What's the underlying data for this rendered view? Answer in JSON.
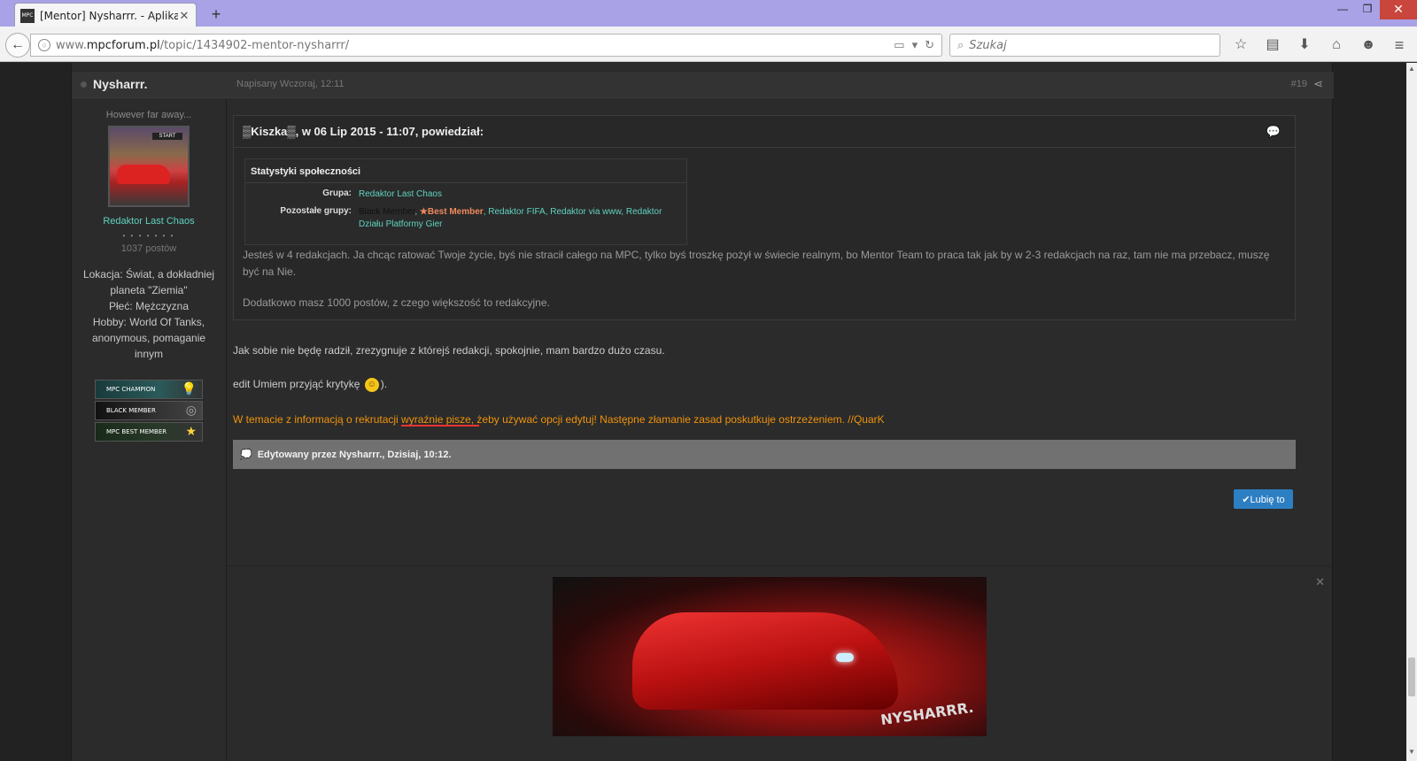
{
  "browser": {
    "tab_title": "[Mentor] Nysharrr. - Aplika...",
    "favicon_text": "MPC",
    "url_prefix": "www.",
    "url_domain": "mpcforum.pl",
    "url_path": "/topic/1434902-mentor-nysharrr/",
    "search_placeholder": "Szukaj"
  },
  "post": {
    "author": "Nysharrr.",
    "date": "Napisany Wczoraj, 12:11",
    "number": "#19"
  },
  "sidebar": {
    "user_title": "However far away...",
    "group": "Redaktor Last Chaos",
    "pips": "• • • • • • •",
    "post_count": "1037 postów",
    "fields": [
      "Lokacja: Świat, a dokładniej planeta \"Ziemia\"",
      "Płeć: Mężczyzna",
      "Hobby: World Of Tanks, anonymous, pomaganie innym"
    ],
    "badges": [
      "MPC CHAMPION",
      "BLACK MEMBER",
      "MPC BEST MEMBER"
    ]
  },
  "quote": {
    "header": "▒Kiszka▒, w 06 Lip 2015 - 11:07, powiedział:",
    "stats_title": "Statystyki społeczności",
    "group_label": "Grupa:",
    "group_value": "Redaktor Last Chaos",
    "other_label": "Pozostałe grupy:",
    "other_black": "Black Member",
    "other_best": "★Best Member",
    "other_rest": ", Redaktor FIFA, Redaktor via www, Redaktor Działu Platformy Gier",
    "text1": "Jesteś w 4 redakcjach. Ja chcąc ratować Twoje życie, byś nie stracił całego na MPC, tylko byś troszkę pożył w świecie realnym, bo Mentor Team to praca tak jak by w 2-3 redakcjach na raz, tam nie ma przebacz, muszę być na Nie.",
    "text2": "Dodatkowo masz 1000 postów, z czego większość to redakcyjne."
  },
  "body": {
    "p1": "Jak sobie nie będę radził, zrezygnuje z którejś redakcji, spokojnie, mam bardzo dużo czasu.",
    "p2_before": "edit Umiem przyjąć krytykę",
    "p2_after": ").",
    "warning": "W temacie z informacją o rekrutacji wyraźnie pisze, żeby używać opcji edytuj! Następne złamanie zasad poskutkuje ostrzeżeniem. //QuarK",
    "edited": "Edytowany przez Nysharrr., Dzisiaj, 10:12.",
    "like_label": "✔Lubię to"
  },
  "signature": {
    "text": "NYSHARRR."
  }
}
